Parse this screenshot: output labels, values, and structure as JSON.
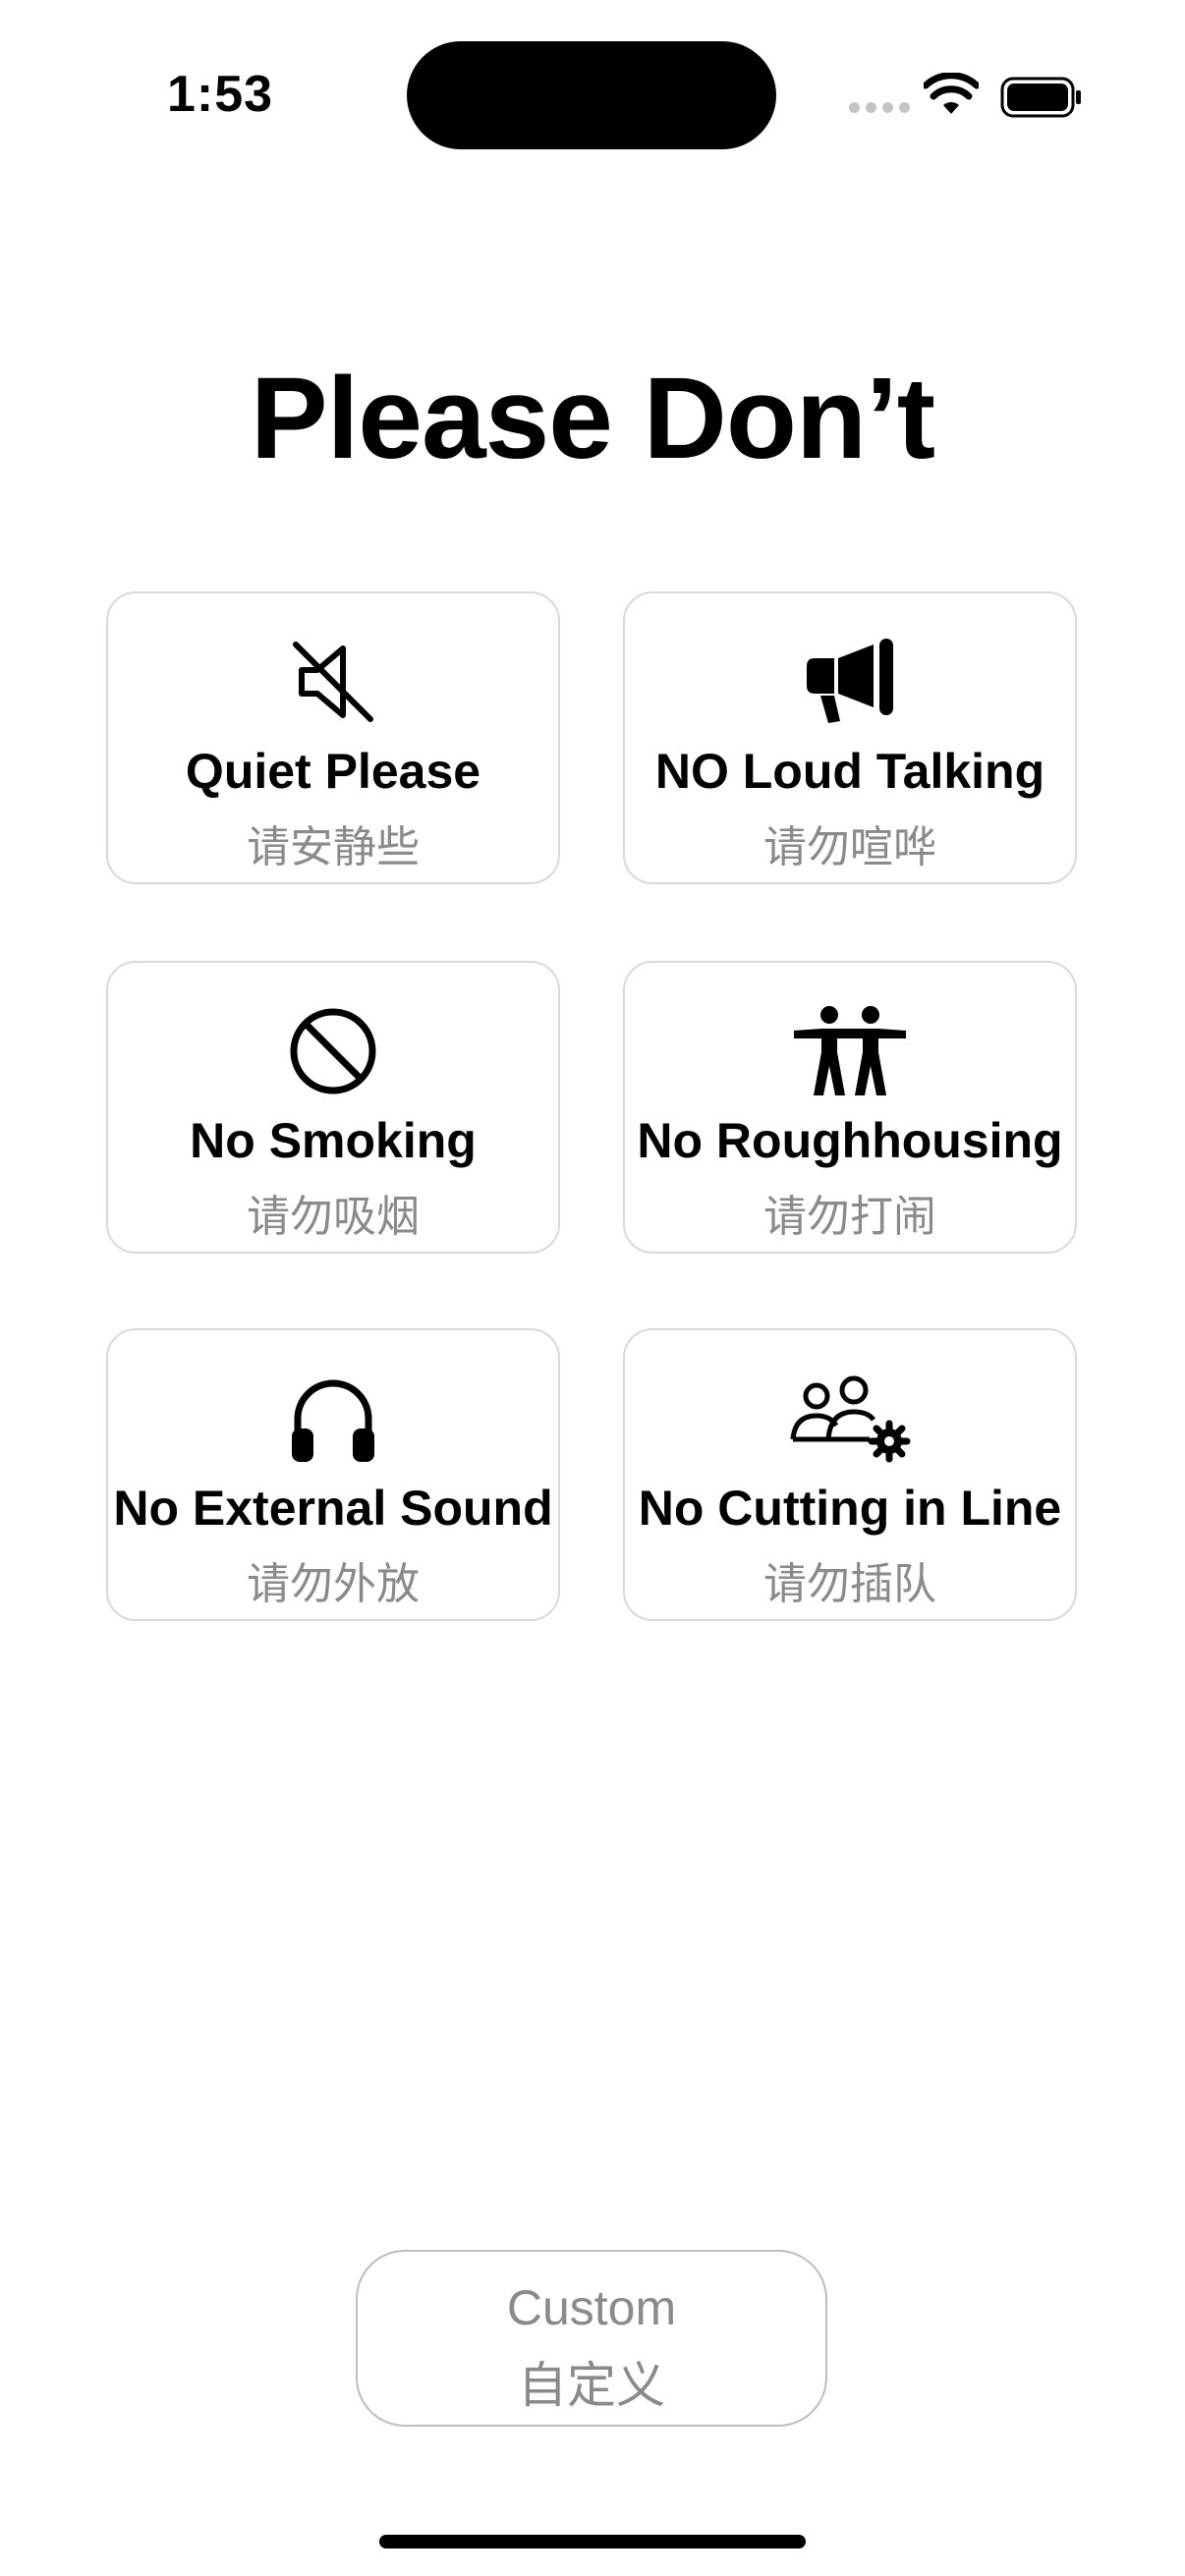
{
  "status_bar": {
    "time": "1:53"
  },
  "title": "Please Don’t",
  "cards": [
    {
      "icon": "speaker-slash-icon",
      "label_en": "Quiet Please",
      "label_zh": "请安静些"
    },
    {
      "icon": "megaphone-icon",
      "label_en": "NO Loud Talking",
      "label_zh": "请勿喧哗"
    },
    {
      "icon": "prohibited-icon",
      "label_en": "No Smoking",
      "label_zh": "请勿吸烟"
    },
    {
      "icon": "two-people-arms-out-icon",
      "label_en": "No Roughhousing",
      "label_zh": "请勿打闹"
    },
    {
      "icon": "headphones-icon",
      "label_en": "No External Sound",
      "label_zh": "请勿外放"
    },
    {
      "icon": "people-queue-gear-icon",
      "label_en": "No Cutting in Line",
      "label_zh": "请勿插队"
    }
  ],
  "custom_button": {
    "label_en": "Custom",
    "label_zh": "自定义"
  }
}
